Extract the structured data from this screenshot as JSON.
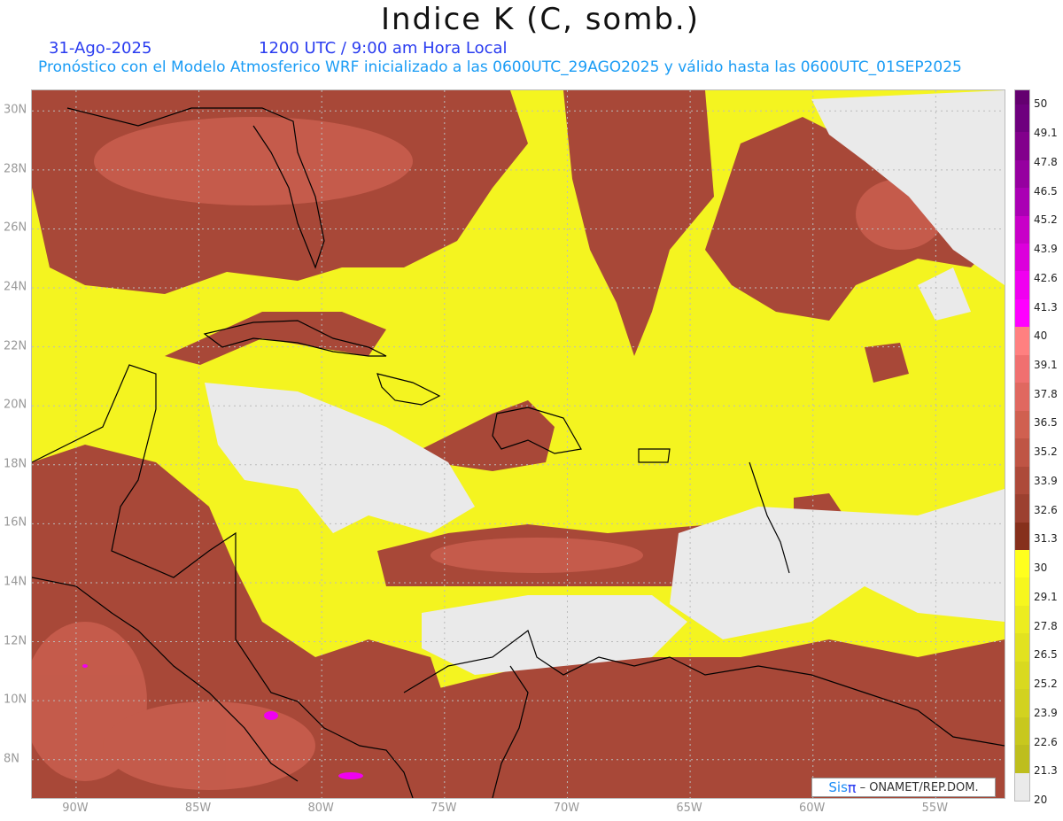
{
  "header": {
    "title": "Indice K (C, somb.)",
    "date": "31-Ago-2025",
    "time": "1200 UTC / 9:00 am Hora Local",
    "description": "Pronóstico con el Modelo Atmosferico WRF inicializado a las 0600UTC_29AGO2025 y válido hasta las  0600UTC_01SEP2025"
  },
  "map": {
    "lon_ticks": [
      "90W",
      "85W",
      "80W",
      "75W",
      "70W",
      "65W",
      "60W",
      "55W"
    ],
    "lon_values": [
      -90,
      -85,
      -80,
      -75,
      -70,
      -65,
      -60,
      -55
    ],
    "lat_ticks": [
      "30N",
      "28N",
      "26N",
      "24N",
      "22N",
      "20N",
      "18N",
      "16N",
      "14N",
      "12N",
      "10N",
      "8N"
    ],
    "lat_values": [
      30,
      28,
      26,
      24,
      22,
      20,
      18,
      16,
      14,
      12,
      10,
      8
    ],
    "lon_range": [
      -91.8,
      -52.2
    ],
    "lat_range": [
      6.7,
      30.7
    ]
  },
  "colorbar": {
    "labels": [
      "50",
      "49.1",
      "47.8",
      "46.5",
      "45.2",
      "43.9",
      "42.6",
      "41.3",
      "40",
      "39.1",
      "37.8",
      "36.5",
      "35.2",
      "33.9",
      "32.6",
      "31.3",
      "30",
      "29.1",
      "27.8",
      "26.5",
      "25.2",
      "23.9",
      "22.6",
      "21.3",
      "20"
    ],
    "colors": [
      "#640070",
      "#6e007e",
      "#82008c",
      "#9600a0",
      "#aa00b4",
      "#c800c8",
      "#dc00dc",
      "#f000f0",
      "#ff00ff",
      "#ff8080",
      "#f07070",
      "#e06860",
      "#d06050",
      "#bf5545",
      "#ad4a3a",
      "#9c4030",
      "#86301c",
      "#ffff1e",
      "#f6f61e",
      "#ecec20",
      "#e2e220",
      "#d9d91f",
      "#d2d21f",
      "#c8c81e",
      "#bebe1e",
      "#eaeaea"
    ]
  },
  "credit": {
    "sis": "Sis",
    "pi": "π",
    "text": "– ONAMET/REP.DOM."
  }
}
